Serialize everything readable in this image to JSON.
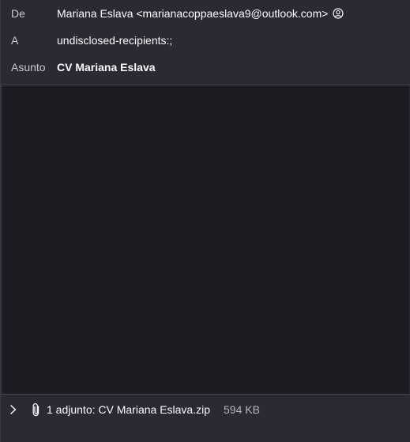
{
  "header": {
    "from_label": "De",
    "from_value": "Mariana Eslava <marianacoppaeslava9@outlook.com>",
    "to_label": "A",
    "to_value": "undisclosed-recipients:;",
    "subject_label": "Asunto",
    "subject_value": "CV Mariana Eslava"
  },
  "attachments": {
    "summary": "1 adjunto: CV Mariana Eslava.zip",
    "size": "594 KB"
  },
  "icons": {
    "contact": "contact-icon",
    "expand": "chevron-right-icon",
    "attachment": "paperclip-icon"
  }
}
